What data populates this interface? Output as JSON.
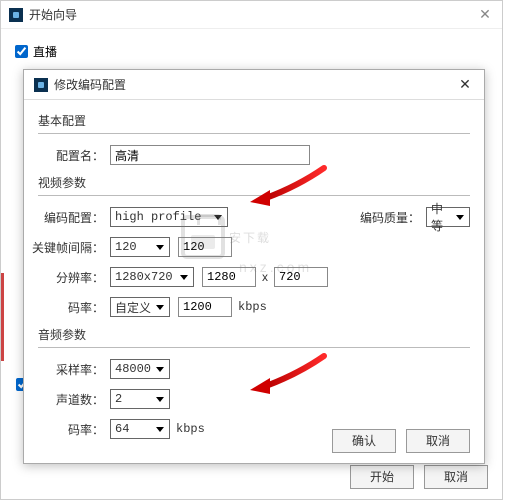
{
  "outer": {
    "title": "开始向导",
    "live_label": "直播",
    "start_btn": "开始",
    "cancel_btn": "取消"
  },
  "modal": {
    "title": "修改编码配置",
    "basic_group": "基本配置",
    "video_group": "视频参数",
    "audio_group": "音频参数",
    "labels": {
      "config_name": "配置名：",
      "encode_profile": "编码配置：",
      "encode_quality": "编码质量：",
      "keyframe_interval": "关键帧间隔：",
      "resolution": "分辨率：",
      "bitrate": "码率：",
      "sample_rate": "采样率：",
      "channels": "声道数：",
      "audio_bitrate": "码率："
    },
    "values": {
      "config_name": "高清",
      "encode_profile": "high profile",
      "encode_quality": "中等",
      "keyframe_drop": "120",
      "keyframe_box": "120",
      "resolution_drop": "1280x720",
      "res_w": "1280",
      "res_h": "720",
      "bitrate_mode": "自定义",
      "bitrate_val": "1200",
      "bitrate_unit": "kbps",
      "sample_rate": "48000",
      "channels": "2",
      "audio_bitrate": "64",
      "audio_bitrate_unit": "kbps"
    },
    "x_sep": "x",
    "ok_btn": "确认",
    "cancel_btn": "取消"
  },
  "watermark": {
    "main": "安下载",
    "sub": "nxz.com"
  }
}
